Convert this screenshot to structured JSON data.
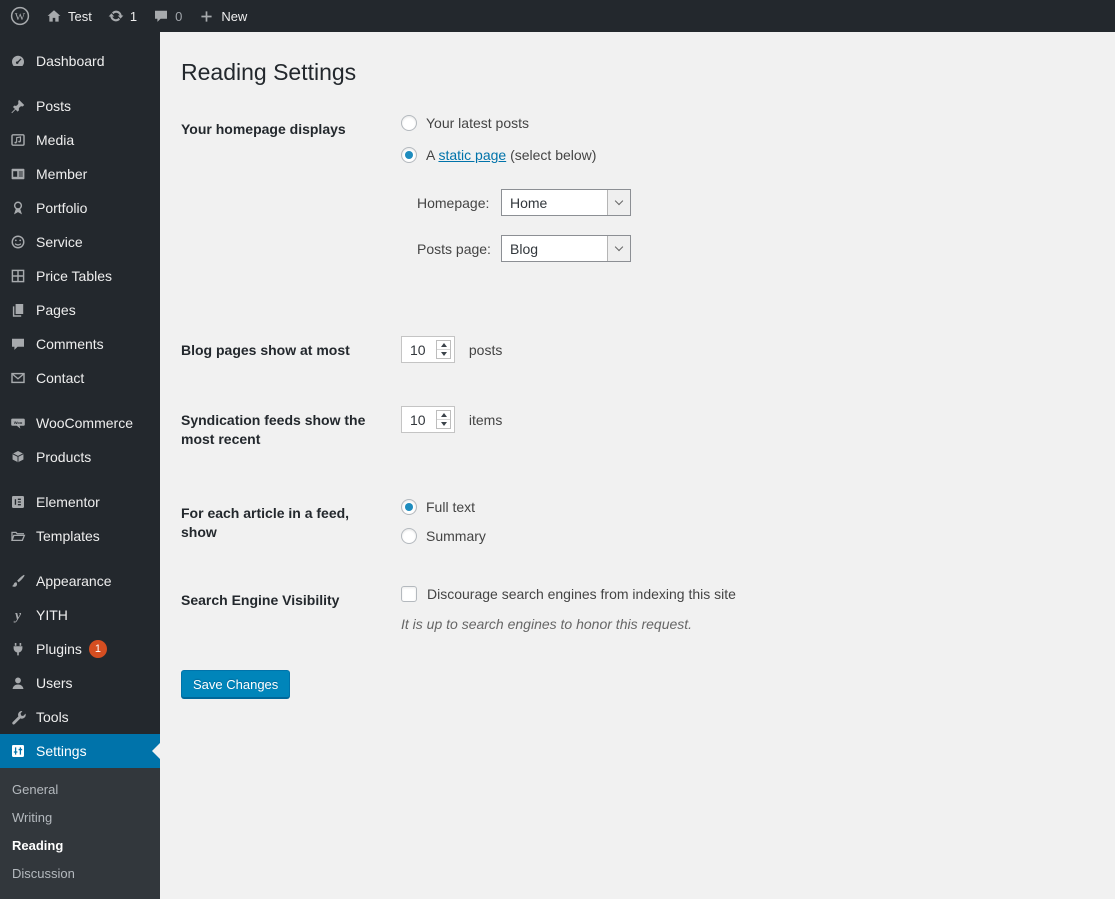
{
  "admin_bar": {
    "wp_logo_icon": "wordpress-logo-icon",
    "site": {
      "icon": "home-icon",
      "label": "Test"
    },
    "updates": {
      "icon": "updates-icon",
      "count": "1"
    },
    "comments": {
      "icon": "comments-bubble-icon",
      "count": "0"
    },
    "new_item": {
      "icon": "plus-icon",
      "label": "New"
    }
  },
  "sidebar": {
    "items": [
      {
        "label": "Dashboard",
        "icon": "dashboard-icon"
      },
      {
        "label": "Posts",
        "icon": "pushpin-icon",
        "separator_before": true
      },
      {
        "label": "Media",
        "icon": "media-icon"
      },
      {
        "label": "Member",
        "icon": "id-card-icon"
      },
      {
        "label": "Portfolio",
        "icon": "award-icon"
      },
      {
        "label": "Service",
        "icon": "smiley-icon"
      },
      {
        "label": "Price Tables",
        "icon": "grid-icon"
      },
      {
        "label": "Pages",
        "icon": "pages-icon"
      },
      {
        "label": "Comments",
        "icon": "comment-icon"
      },
      {
        "label": "Contact",
        "icon": "envelope-icon"
      },
      {
        "label": "WooCommerce",
        "icon": "woo-icon",
        "separator_before": true
      },
      {
        "label": "Products",
        "icon": "box-icon"
      },
      {
        "label": "Elementor",
        "icon": "elementor-icon",
        "separator_before": true
      },
      {
        "label": "Templates",
        "icon": "folder-icon"
      },
      {
        "label": "Appearance",
        "icon": "brush-icon",
        "separator_before": true
      },
      {
        "label": "YITH",
        "icon": "yith-icon"
      },
      {
        "label": "Plugins",
        "icon": "plugin-icon",
        "badge": "1"
      },
      {
        "label": "Users",
        "icon": "user-icon"
      },
      {
        "label": "Tools",
        "icon": "wrench-icon"
      },
      {
        "label": "Settings",
        "icon": "sliders-icon",
        "active": true
      }
    ],
    "submenu": [
      {
        "label": "General"
      },
      {
        "label": "Writing"
      },
      {
        "label": "Reading",
        "current": true
      },
      {
        "label": "Discussion"
      }
    ]
  },
  "main": {
    "title": "Reading Settings",
    "homepage_displays": {
      "label": "Your homepage displays",
      "option_latest": "Your latest posts",
      "latest_selected": false,
      "option_static_prefix": "A ",
      "option_static_link": "static page",
      "option_static_suffix": " (select below)",
      "static_selected": true,
      "homepage_label": "Homepage:",
      "homepage_value": "Home",
      "posts_page_label": "Posts page:",
      "posts_page_value": "Blog"
    },
    "blog_pages": {
      "label": "Blog pages show at most",
      "value": "10",
      "unit": "posts"
    },
    "syndication": {
      "label": "Syndication feeds show the most recent",
      "value": "10",
      "unit": "items"
    },
    "feed_article": {
      "label": "For each article in a feed, show",
      "option_full": "Full text",
      "full_selected": true,
      "option_summary": "Summary",
      "summary_selected": false
    },
    "search_visibility": {
      "label": "Search Engine Visibility",
      "checkbox_label": "Discourage search engines from indexing this site",
      "checkbox_checked": false,
      "description": "It is up to search engines to honor this request."
    },
    "save_button": "Save Changes"
  },
  "colors": {
    "admin_bar_bg": "#23282d",
    "menu_bg": "#23282d",
    "submenu_bg": "#32373c",
    "active_item_bg": "#0073aa",
    "content_bg": "#f1f1f1",
    "link": "#0073aa",
    "button_bg": "#0085ba",
    "badge_bg": "#d54e21",
    "radio_checked": "#1e8cbe"
  }
}
